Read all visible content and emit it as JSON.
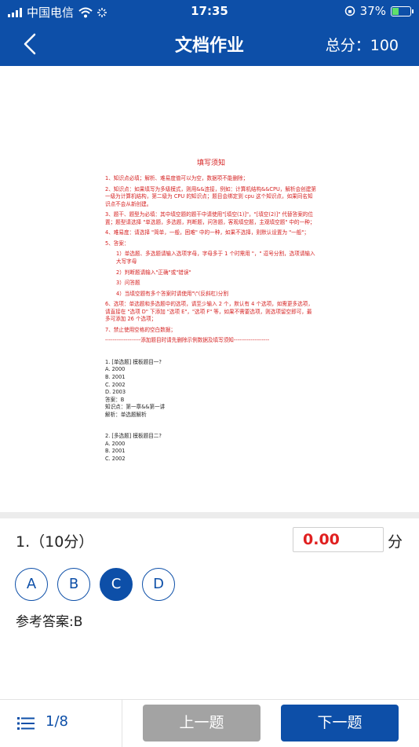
{
  "status_bar": {
    "carrier": "中国电信",
    "time": "17:35",
    "battery": "37%"
  },
  "nav": {
    "title": "文档作业",
    "score_label": "总分：100"
  },
  "document": {
    "title": "填写须知",
    "rules": [
      "1、知识点必填；解析、难易度值可以为空，数据项不能删除；",
      "2、知识点：如果填写为多级模式，则用&&连接，例如：计算机结构&&CPU，解析会创建第一级为计算机结构，第二级为 CPU 的知识点；题目会绑定到 cpu 这个知识点，如果同名知识点不会从新创建。",
      "3、题干、题型为必填：其中填空题的题干中请使用\"[填空(1)]\"，\"[填空(2)]\" 代替答案的位置；题型请选择 \"单选题，多选题，判断题，问答题，客观填空题，主观填空题\" 中的一种；",
      "4、难易度：请选择 \"简单，一般，困难\" 中的一种，如果不选择，则默认设置为 \"一般\"；",
      "5、答案："
    ],
    "answer_rules": [
      "1）单选题、多选题请输入选项字母，字母多于 1 个时需用 \"，\" 逗号分割，选项请输入大写字母",
      "2）判断题请输入\"正确\"或\"错误\"",
      "3）问答题",
      "4）当填空题有多个答案时请使用\"\\\"(反斜杠)分割"
    ],
    "rules_cont": [
      "6、选项：单选题和多选题中的选项，请至少输入 2 个，默认有 4 个选项，如需更多选项，请直接在 \"选项 D\" 下添加 \"选项 E\"，\"选项 F\" 等，如果不需要选项，则选项留空即可，最多可添加 26 个选项；",
      "7、禁止使用空格的空白数据；",
      "-------------------添加题目时请先删除示例数据及填写须知-------------------"
    ],
    "q1": {
      "stem": "1. [单选题] 模板题目一?",
      "options": [
        "A.  2000",
        "B.  2001",
        "C.  2002",
        "D.  2003"
      ],
      "answer": "答案：B",
      "knowledge": "知识点：第一章&&第一讲",
      "analysis": "解析：单选题解析"
    },
    "q2": {
      "stem": "2. [多选题] 模板题目二?",
      "options": [
        "A.  2000",
        "B.  2001",
        "C.  2002"
      ]
    }
  },
  "question": {
    "label": "1.（10分）",
    "score_value": "0.00",
    "score_unit": "分",
    "options": [
      "A",
      "B",
      "C",
      "D"
    ],
    "selected": "C",
    "reference_answer": "参考答案:B"
  },
  "footer": {
    "page": "1/8",
    "prev_label": "上一题",
    "next_label": "下一题"
  },
  "colors": {
    "primary": "#0d4fa8",
    "red_text": "#d51f1f",
    "disabled": "#a3a3a3"
  }
}
